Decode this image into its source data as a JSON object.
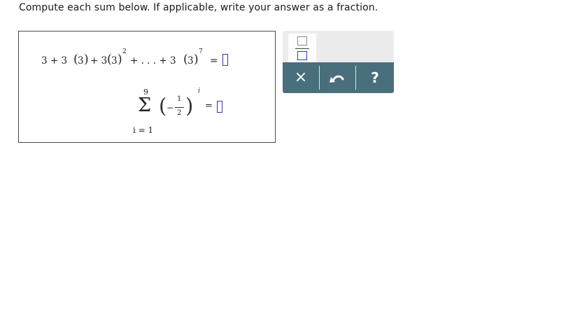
{
  "prompt": "Compute each sum below. If applicable, write your answer as a fraction.",
  "problem1": {
    "term1": "3 + 3",
    "base_a": "3",
    "plus": "+ 3",
    "base_b": "3",
    "exp2": "2",
    "ellipsis": "+ . . . + 3",
    "base_c": "3",
    "exp7": "7",
    "equals": "="
  },
  "problem2": {
    "upper_limit": "9",
    "sigma": "Σ",
    "minus": "−",
    "numerator": "1",
    "denominator": "2",
    "exponent": "i",
    "equals": "=",
    "lower_limit": "i = 1"
  },
  "toolbar": {
    "fraction_icon": "fraction-template-icon",
    "clear_label": "×",
    "undo_icon": "undo-icon",
    "help_label": "?",
    "accent_color": "#4a6f7c"
  }
}
